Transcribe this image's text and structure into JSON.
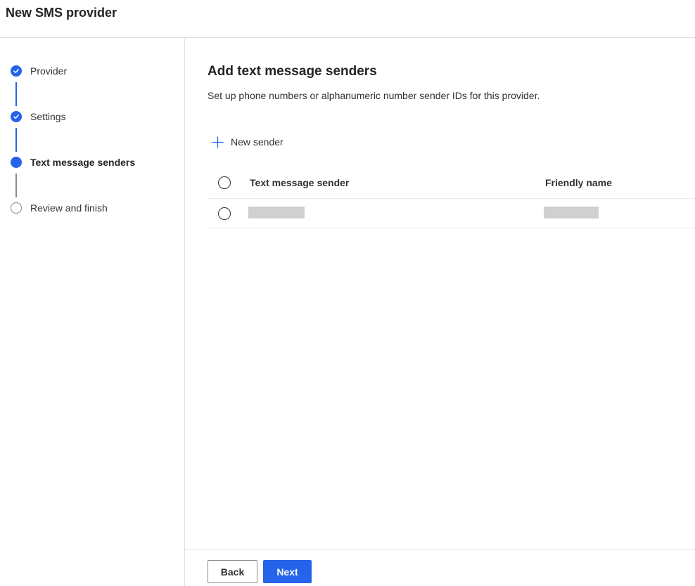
{
  "header": {
    "title": "New SMS provider"
  },
  "steps": [
    {
      "label": "Provider",
      "state": "done"
    },
    {
      "label": "Settings",
      "state": "done"
    },
    {
      "label": "Text message senders",
      "state": "current"
    },
    {
      "label": "Review and finish",
      "state": "todo"
    }
  ],
  "main": {
    "title": "Add text message senders",
    "description": "Set up phone numbers or alphanumeric number sender IDs for this provider.",
    "new_sender_label": "New sender",
    "table": {
      "columns": [
        "Text message sender",
        "Friendly name"
      ],
      "rows": [
        {
          "sender": "",
          "friendly_name": "",
          "redacted": true
        }
      ]
    }
  },
  "footer": {
    "back_label": "Back",
    "next_label": "Next"
  },
  "colors": {
    "accent": "#2563eb",
    "border": "#e0e0e0",
    "placeholder": "#d0d0d0"
  },
  "icons": {
    "step_done": "checkmark-circle-icon",
    "step_current": "filled-circle-icon",
    "step_todo": "empty-circle-icon",
    "new_sender": "plus-icon"
  }
}
